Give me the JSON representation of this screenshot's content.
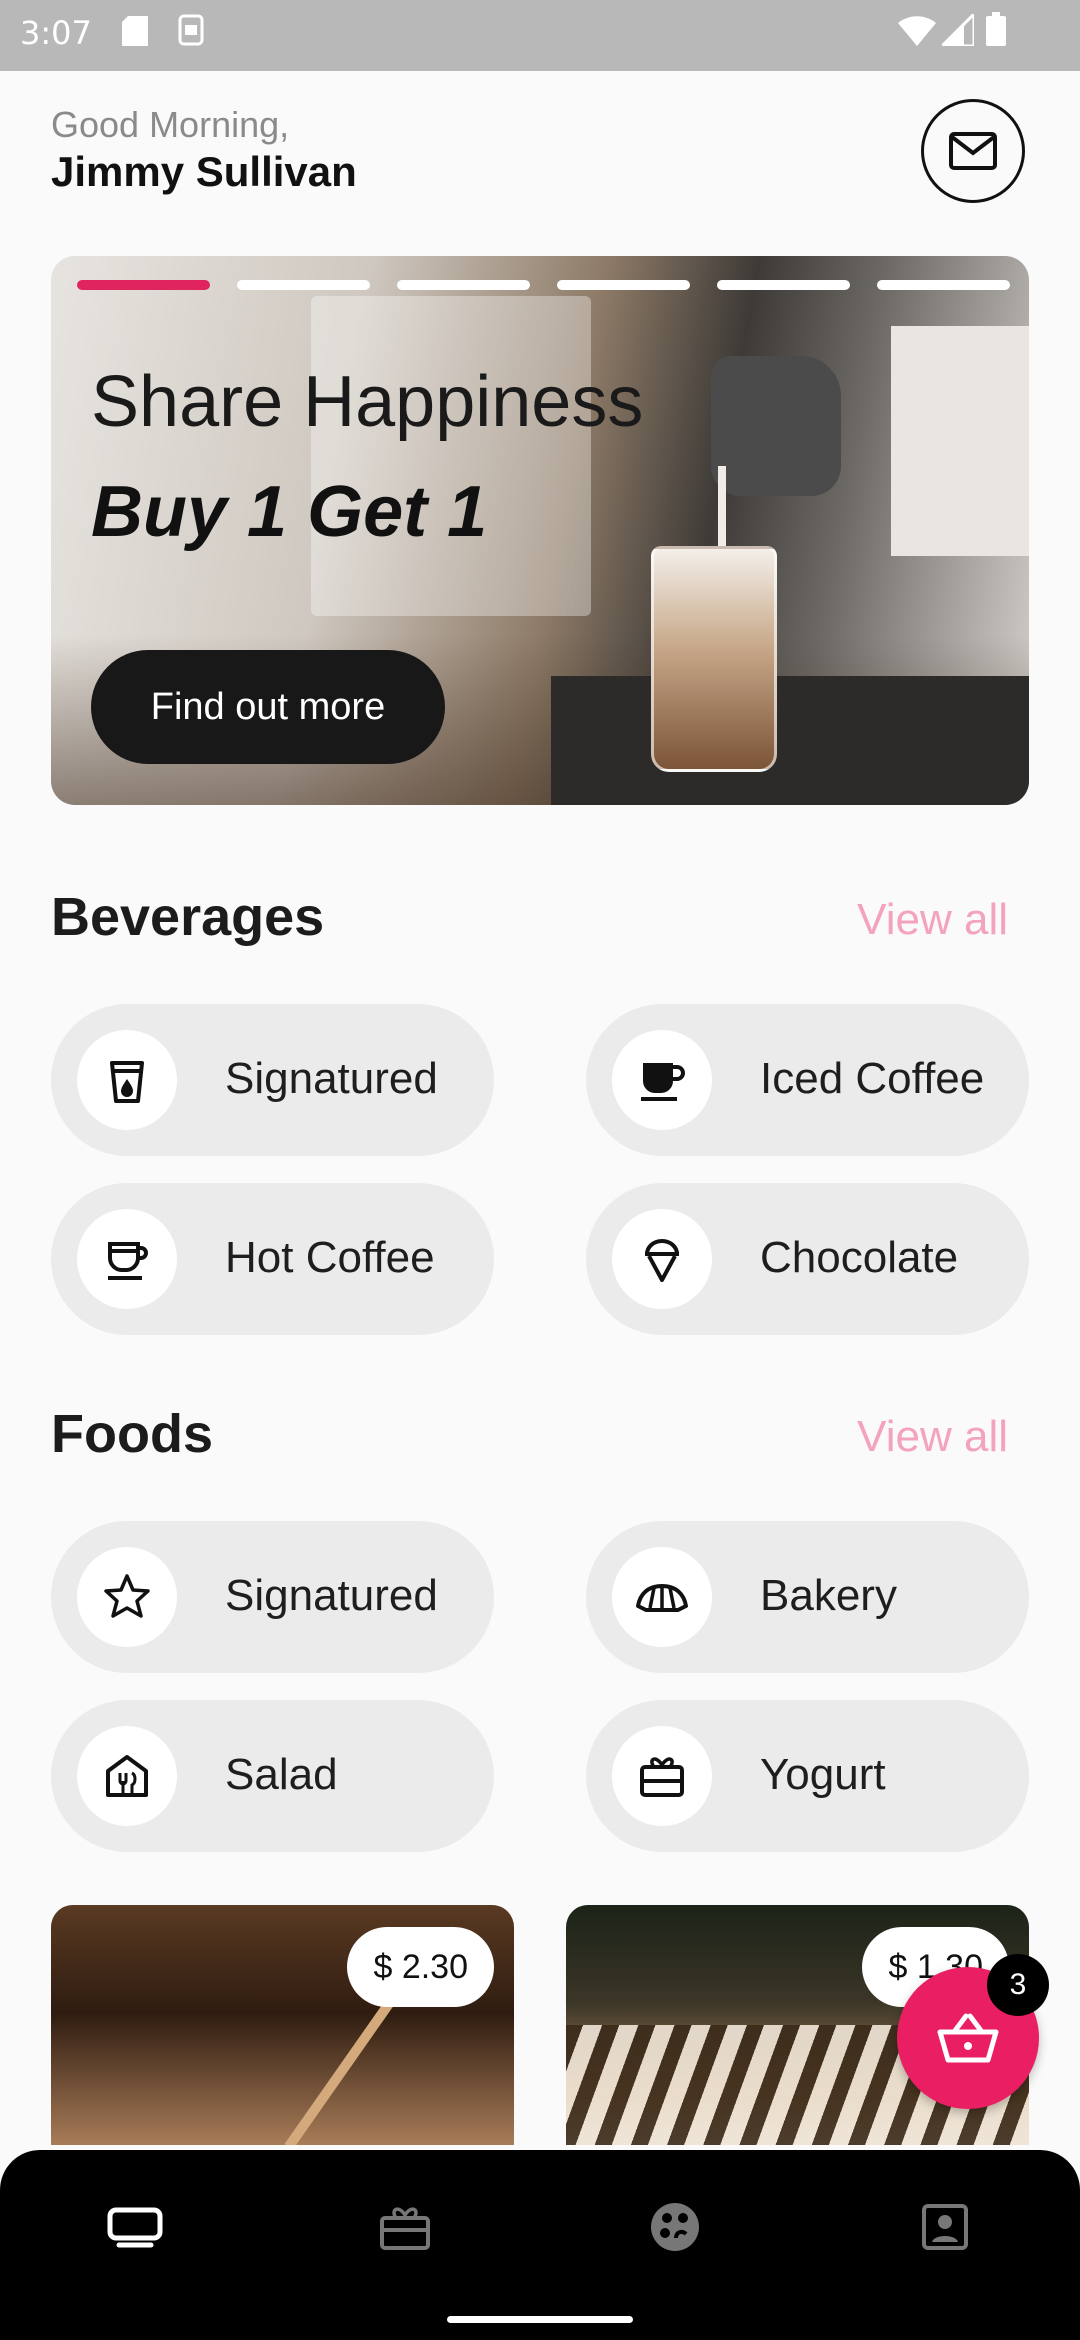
{
  "status_bar": {
    "time": "3:07"
  },
  "header": {
    "greeting": "Good Morning,",
    "user_name": "Jimmy Sullivan"
  },
  "banner": {
    "title": "Share Happiness",
    "subtitle": "Buy 1 Get 1",
    "button_label": "Find out more",
    "slides_total": 6,
    "active_slide": 1
  },
  "beverages": {
    "title": "Beverages",
    "view_all": "View all",
    "items": [
      {
        "label": "Signatured",
        "icon": "cup-drop-icon"
      },
      {
        "label": "Iced Coffee",
        "icon": "mug-icon"
      },
      {
        "label": "Hot Coffee",
        "icon": "hot-cup-icon"
      },
      {
        "label": "Chocolate",
        "icon": "ice-cream-icon"
      }
    ]
  },
  "foods": {
    "title": "Foods",
    "view_all": "View all",
    "items": [
      {
        "label": "Signatured",
        "icon": "star-icon"
      },
      {
        "label": "Bakery",
        "icon": "croissant-icon"
      },
      {
        "label": "Salad",
        "icon": "fork-knife-house-icon"
      },
      {
        "label": "Yogurt",
        "icon": "gift-box-icon"
      }
    ]
  },
  "products": [
    {
      "price": "$ 2.30"
    },
    {
      "price": "$ 1.30"
    }
  ],
  "cart": {
    "count": "3"
  },
  "colors": {
    "accent": "#e91e63",
    "view_all": "#f3a2bf",
    "nav_bg": "#000000"
  },
  "bottom_nav": [
    "home-icon",
    "rewards-icon",
    "menu-icon",
    "profile-icon"
  ]
}
